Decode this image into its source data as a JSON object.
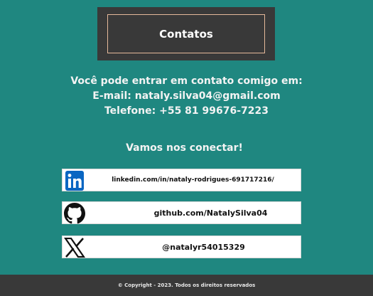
{
  "header": {
    "title": "Contatos"
  },
  "contact": {
    "intro": "Você pode entrar em contato comigo em:",
    "email_line": "E-mail: nataly.silva04@gmail.com",
    "phone_line": "Telefone: +55 81 99676-7223"
  },
  "social": {
    "heading": "Vamos nos conectar!",
    "links": [
      {
        "icon": "linkedin-icon",
        "label": "linkedin.com/in/nataly-rodrigues-691717216/"
      },
      {
        "icon": "github-icon",
        "label": "github.com/NatalySilva04"
      },
      {
        "icon": "x-icon",
        "label": "@natalyr54015329"
      }
    ]
  },
  "footer": {
    "copyright": "© Copyright - 2023. Todos os direitos reservados"
  },
  "colors": {
    "background": "#1f8780",
    "panel": "#393939",
    "title_border": "#e5b99a",
    "linkedin_blue": "#0a66c2"
  }
}
